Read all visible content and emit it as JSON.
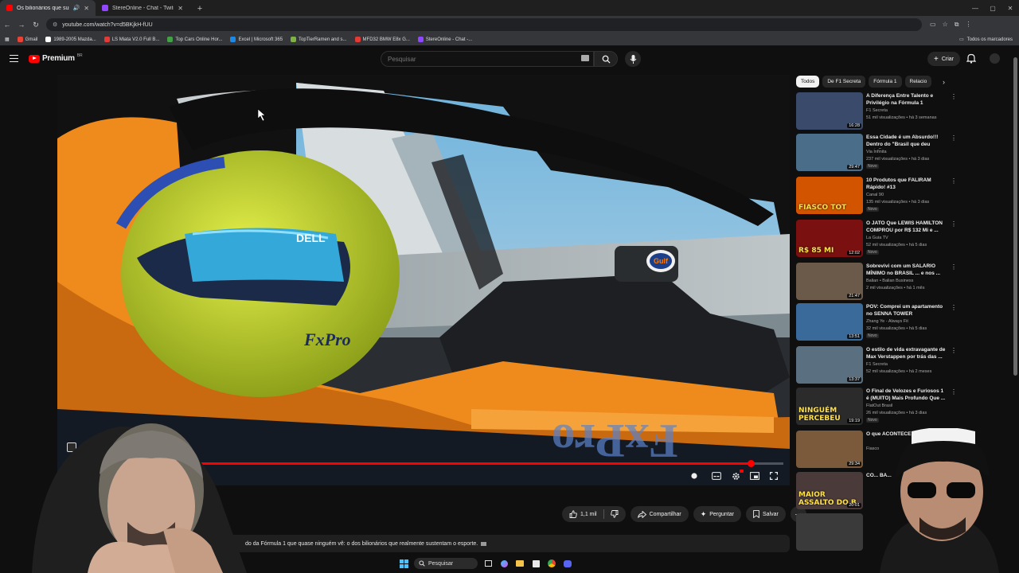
{
  "browser": {
    "tabs": [
      {
        "title": "Os bilionários que sustent",
        "favicon_color": "#ff0000",
        "active": true
      },
      {
        "title": "StereOnline - Chat - Twitch",
        "favicon_color": "#9146ff",
        "active": false
      }
    ],
    "address": "youtube.com/watch?v=d5BKjkH-fUU",
    "bookmarks": [
      {
        "label": "Gmail",
        "color": "#ea4335"
      },
      {
        "label": "1989-2005 Mazda...",
        "color": "#ffffff"
      },
      {
        "label": "LS Miata V2.0 Full B...",
        "color": "#e53935"
      },
      {
        "label": "Top Cars Online Hor...",
        "color": "#43a047"
      },
      {
        "label": "Excel | Microsoft 365",
        "color": "#1e88e5"
      },
      {
        "label": "TopTierRamen and s...",
        "color": "#7cb342"
      },
      {
        "label": "MFD32 BMW E8x G...",
        "color": "#e53935"
      },
      {
        "label": "StereOnline - Chat -...",
        "color": "#9146ff"
      }
    ],
    "all_bookmarks": "Todos os marcadores"
  },
  "youtube": {
    "brand": "Premium",
    "brand_region": "BR",
    "search_placeholder": "Pesquisar",
    "create_label": "Criar"
  },
  "player": {
    "progress": 0.955,
    "watched_marker": 0.2,
    "sponsor_text": "Gulf",
    "helmet_text": "DELL",
    "sidepod_text": "FxPro"
  },
  "actions": {
    "likes": "1,1 mil",
    "share": "Compartilhar",
    "ask": "Perguntar",
    "save": "Salvar"
  },
  "description": "do da Fórmula 1 que quase ninguém vê: o dos bilionários que realmente sustentam o esporte.",
  "chips": [
    "Todos",
    "De F1 Secreta",
    "Fórmula 1",
    "Relacio"
  ],
  "recommendations": [
    {
      "title": "A Diferença Entre Talento e Privilégio na Fórmula 1",
      "channel": "F1 Secreta",
      "meta": "51 mil visualizações • há 3 semanas",
      "badge": "",
      "duration": "16:28",
      "thumb_color": "#3a4a6a"
    },
    {
      "title": "Essa Cidade é um Absurdo!!! Dentro do \"Brasil que deu certo\"",
      "channel": "Via Infinita",
      "meta": "237 mil visualizações • há 3 dias",
      "badge": "Novo",
      "duration": "29:47",
      "thumb_color": "#4a6d8a"
    },
    {
      "title": "10 Produtos que FALIRAM Rápido! #13",
      "channel": "Canal 90",
      "meta": "135 mil visualizações • há 3 dias",
      "badge": "Novo",
      "duration": "",
      "thumb_color": "#d35400",
      "thumb_text": "FIASCO TOT"
    },
    {
      "title": "O JATO Que LEWIS HAMILTON COMPROU por R$ 132 Mi e ...",
      "channel": "La Guia TV",
      "meta": "52 mil visualizações • há 5 dias",
      "badge": "Novo",
      "duration": "12:02",
      "thumb_color": "#7a1010",
      "thumb_text": "R$ 85 MI"
    },
    {
      "title": "Sobrevivi com um SALÁRIO MÍNIMO no BRASIL ... e nos ...",
      "channel": "Balian • Balian Business",
      "meta": "2 mil visualizações • há 1 mês",
      "badge": "",
      "duration": "21:47",
      "thumb_color": "#6b5a4a"
    },
    {
      "title": "POV: Comprei um apartamento no SENNA TOWER",
      "channel": "Zhang Ye - Always Fit",
      "meta": "32 mil visualizações • há 5 dias",
      "badge": "Novo",
      "duration": "13:51",
      "thumb_color": "#3a6a9a"
    },
    {
      "title": "O estilo de vida extravagante de Max Verstappen por trás das ...",
      "channel": "F1 Secreta",
      "meta": "52 mil visualizações • há 2 meses",
      "badge": "",
      "duration": "13:37",
      "thumb_color": "#5a6f80"
    },
    {
      "title": "O Final de Velozes e Furiosos 1 é (MUITO) Mais Profundo Que ...",
      "channel": "FlatOut Brasil",
      "meta": "26 mil visualizações • há 3 dias",
      "badge": "Novo",
      "duration": "19:19",
      "thumb_color": "#2b2b2b",
      "thumb_text": "NINGUÉM PERCEBEU"
    },
    {
      "title": "O que ACONTECE NO HOTEL ...",
      "channel": "Fiasco",
      "meta": "",
      "badge": "",
      "duration": "29:34",
      "thumb_color": "#7a5a3a"
    },
    {
      "title": "CO... BA...",
      "channel": "",
      "meta": "",
      "badge": "",
      "duration": "20:01",
      "thumb_color": "#4a3a3a",
      "thumb_text": "MAIOR ASSALTO DO B"
    },
    {
      "title": "",
      "channel": "",
      "meta": "",
      "badge": "",
      "duration": "",
      "thumb_color": "#3a3a3a"
    }
  ],
  "taskbar": {
    "search": "Pesquisar"
  }
}
